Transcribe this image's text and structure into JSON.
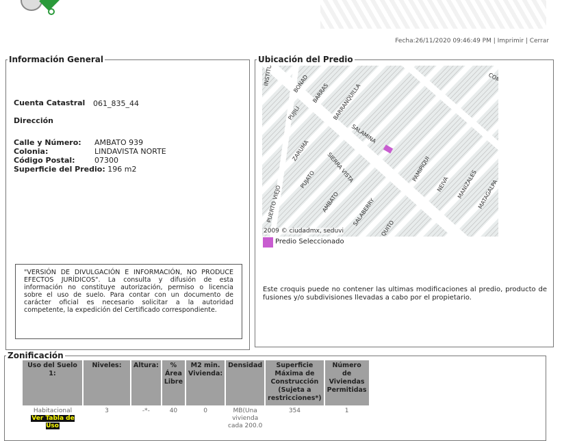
{
  "header": {
    "fecha": "Fecha:26/11/2020 09:46:49 PM",
    "sep": " | ",
    "imprimir": "Imprimir",
    "cerrar": "Cerrar"
  },
  "general": {
    "legend": "Información General",
    "cuenta_label": "Cuenta Catastral",
    "cuenta_value": "061_835_44",
    "direccion_label": "Dirección",
    "calle_label": "Calle y Número:",
    "calle_value": "AMBATO 939",
    "colonia_label": "Colonia:",
    "colonia_value": "LINDAVISTA NORTE",
    "cp_label": "Código Postal:",
    "cp_value": "07300",
    "superficie_label": "Superficie del Predio:",
    "superficie_value": "196 m2",
    "note": "\"VERSIÓN DE DIVULGACIÓN E INFORMACIÓN, NO PRODUCE EFECTOS JURÍDICOS\". La consulta y difusión de esta información no constituye autorización, permiso o licencia sobre el uso de suelo. Para contar con un documento de carácter oficial es necesario solicitar a la autoridad competente, la expedición del Certificado correspondiente."
  },
  "ubicacion": {
    "legend": "Ubicación del Predio",
    "credit": "2009 © ciudadmx, seduvi",
    "legend_label": "Predio Seleccionado",
    "selected_color": "#c85cd0",
    "streets": [
      "INSTITUTO POLIT.",
      "BONAD",
      "BARRAS",
      "BARRANQUILLA",
      "SALAMINA",
      "PUJILI",
      "SIERRA VISTA",
      "ZARUMA",
      "PUJATO",
      "AMBATO",
      "PUERTO VIEJO",
      "SALABERRY",
      "QUITO",
      "PAMIPIQUI",
      "NEIVA",
      "MANIZALES",
      "MATAGALPA",
      "COM"
    ],
    "note": "Este croquis puede no contener las ultimas modificaciones al predio, producto de fusiones y/o subdivisiones llevadas a cabo por el propietario."
  },
  "zonificacion": {
    "legend": "Zonificación",
    "headers": [
      "Uso del Suelo 1:",
      "Niveles:",
      "Altura:",
      "% Área Libre",
      "M2 min. Vivienda:",
      "Densidad",
      "Superficie Máxima de Construcción (Sujeta a restricciones*)",
      "Número de Viviendas Permitidas"
    ],
    "row": {
      "uso": "Habitacional",
      "ver_tabla": "Ver Tabla de Uso",
      "niveles": "3",
      "altura": "-*-",
      "area_libre": "40",
      "m2_min": "0",
      "densidad": "MB(Una vivienda cada 200.0",
      "superficie": "354",
      "viviendas": "1"
    }
  }
}
